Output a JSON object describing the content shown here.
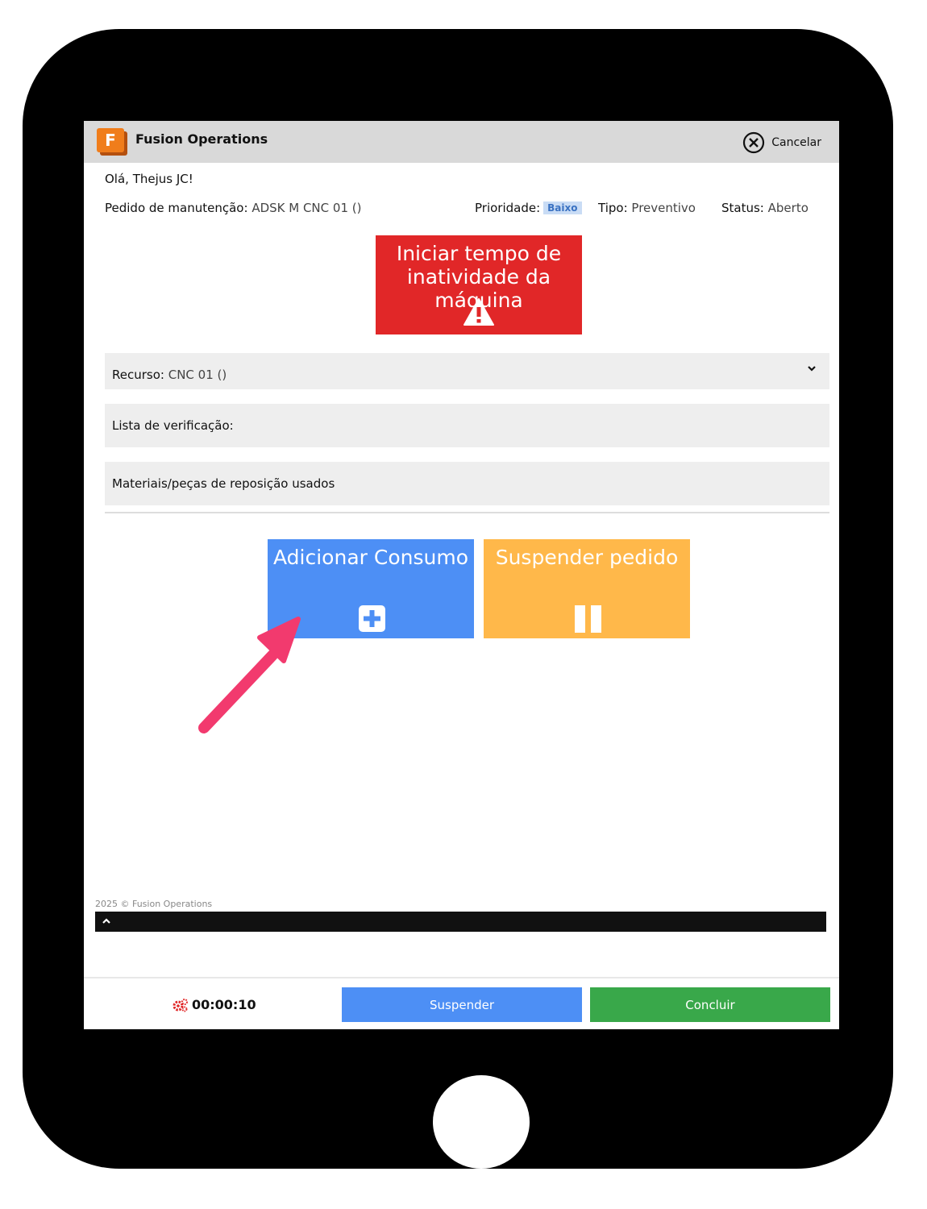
{
  "app": {
    "logo_letter": "F",
    "title": "Fusion Operations",
    "cancel_label": "Cancelar"
  },
  "greeting": "Olá, Thejus JC!",
  "order": {
    "label": "Pedido de manutenção:",
    "value": "ADSK M CNC 01 ()",
    "priority_label": "Prioridade:",
    "priority_value": "Baixo",
    "type_label": "Tipo:",
    "type_value": "Preventivo",
    "status_label": "Status:",
    "status_value": "Aberto"
  },
  "downtime_button": {
    "label": "Iniciar tempo de inatividade da máquina",
    "icon": "warning-icon"
  },
  "sections": {
    "resource_label": "Recurso:",
    "resource_value": "CNC 01 ()",
    "checklist_label": "Lista de verificação:",
    "materials_label": "Materiais/peças de reposição usados"
  },
  "actions": {
    "add_consumption_label": "Adicionar Consumo",
    "suspend_order_label": "Suspender pedido"
  },
  "footer": {
    "copyright": "2025 © Fusion Operations"
  },
  "bottom_bar": {
    "timer": "00:00:10",
    "suspend_label": "Suspender",
    "complete_label": "Concluir"
  },
  "colors": {
    "downtime": "#e12728",
    "add": "#4d8ff5",
    "suspend_order": "#ffb84a",
    "suspend": "#4d8ff5",
    "complete": "#39a84a",
    "annotation_arrow": "#f23a6e"
  }
}
